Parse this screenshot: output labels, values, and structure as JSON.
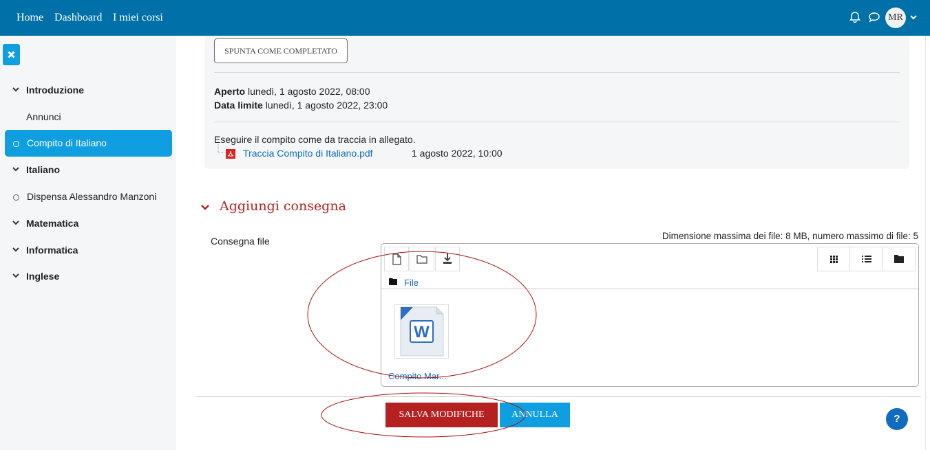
{
  "topbar": {
    "nav": [
      "Home",
      "Dashboard",
      "I miei corsi"
    ],
    "user_initials": "MR",
    "colors": {
      "bar": "#0070a8"
    }
  },
  "drawer": {
    "sections": [
      {
        "label": "Introduzione",
        "type": "section"
      },
      {
        "label": "Annunci",
        "type": "link"
      },
      {
        "label": "Compito di Italiano",
        "type": "activity",
        "active": true
      },
      {
        "label": "Italiano",
        "type": "section"
      },
      {
        "label": "Dispensa Alessandro Manzoni",
        "type": "activity"
      },
      {
        "label": "Matematica",
        "type": "section"
      },
      {
        "label": "Informatica",
        "type": "section"
      },
      {
        "label": "Inglese",
        "type": "section"
      }
    ],
    "colors": {
      "active": "#0f9ee0"
    }
  },
  "assignment": {
    "complete_label": "SPUNTA COME COMPLETATO",
    "opened_label": "Aperto",
    "opened_value": "lunedì, 1 agosto 2022, 08:00",
    "due_label": "Data limite",
    "due_value": "lunedì, 1 agosto 2022, 23:00",
    "description": "Eseguire il compito come da traccia in allegato.",
    "attachment": {
      "name": "Traccia Compito di Italiano.pdf",
      "date": "1 agosto 2022, 10:00"
    }
  },
  "submission": {
    "title": "Aggiungi consegna",
    "field_label": "Consegna file",
    "limits": "Dimensione massima dei file: 8 MB, numero massimo di file: 5",
    "folder_label": "File",
    "file_name": "Compito Mar..."
  },
  "actions": {
    "save_label": "SALVA MODIFICHE",
    "cancel_label": "ANNULLA",
    "help_label": "?",
    "colors": {
      "save": "#b52121",
      "cancel": "#0f9ee0"
    }
  }
}
